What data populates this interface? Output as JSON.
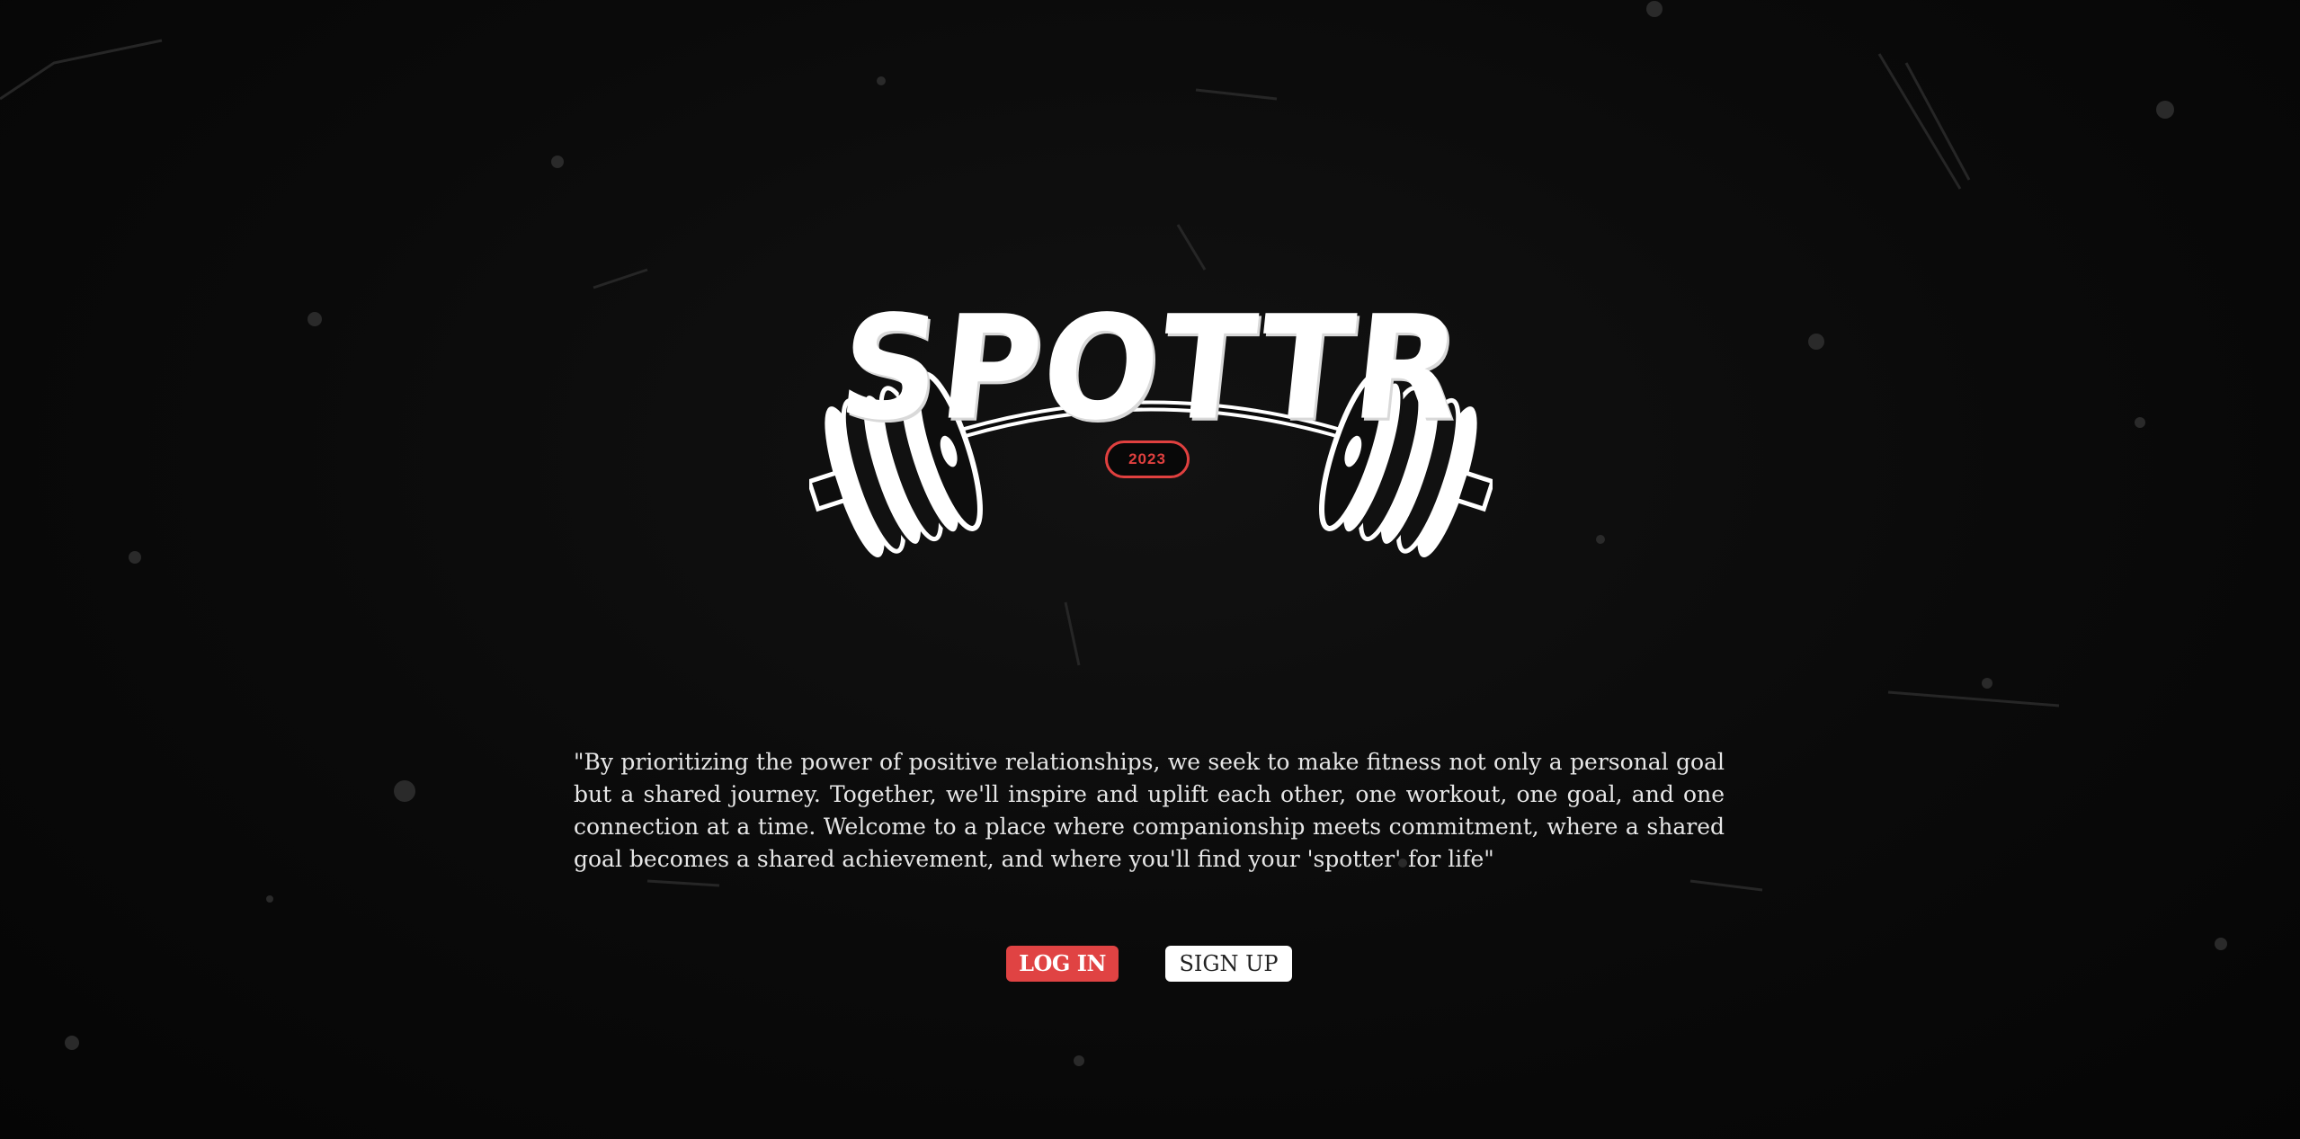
{
  "logo": {
    "wordmark": "SPOTTR",
    "year": "2023"
  },
  "quote": {
    "text": "\"By prioritizing the power of positive relationships, we seek to make fitness not only a personal goal but a shared journey. Together, we'll inspire and uplift each other, one workout, one goal, and one connection at a time. Welcome to a place where companionship meets commitment, where a shared goal becomes a shared achievement, and where you'll find your 'spotter' for life\""
  },
  "actions": {
    "login_label": "LOG IN",
    "signup_label": "SIGN UP"
  },
  "colors": {
    "background": "#070707",
    "accent": "#e04343",
    "text": "#ffffff"
  }
}
